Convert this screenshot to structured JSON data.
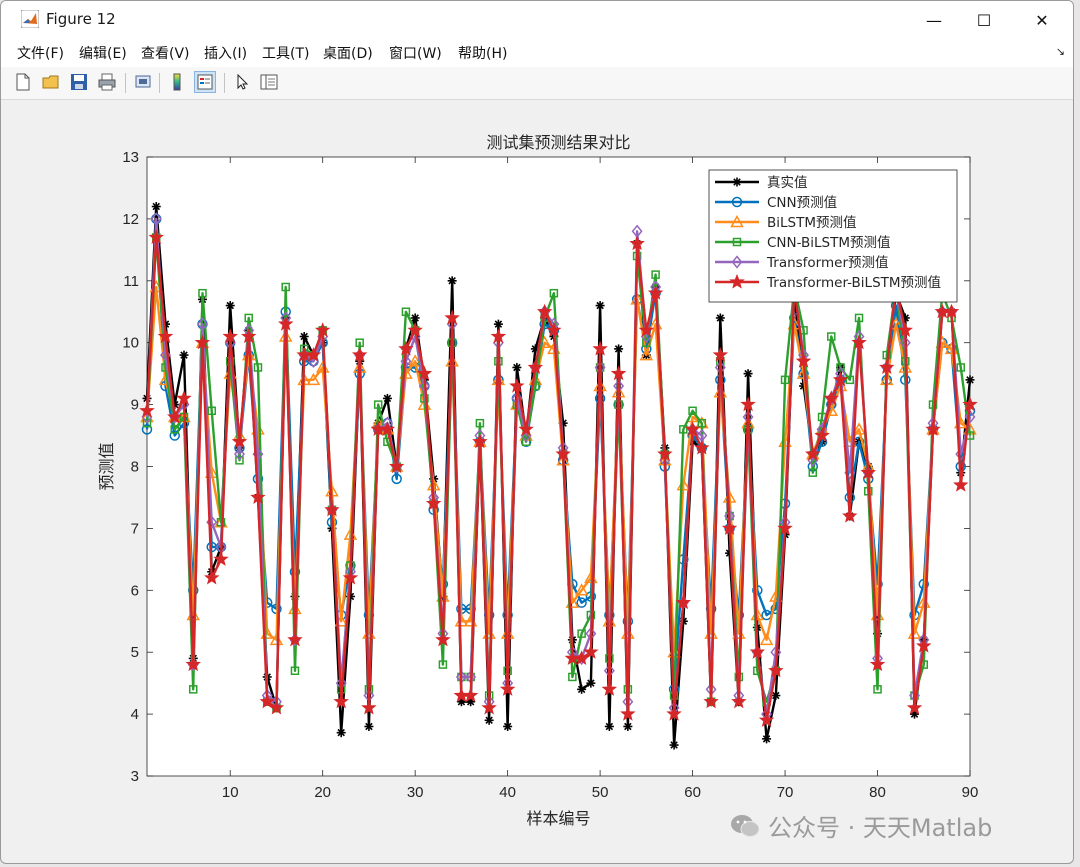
{
  "window": {
    "title": "Figure 12",
    "minimize": "—",
    "maximize": "☐",
    "close": "✕"
  },
  "menu": [
    "文件(F)",
    "编辑(E)",
    "查看(V)",
    "插入(I)",
    "工具(T)",
    "桌面(D)",
    "窗口(W)",
    "帮助(H)"
  ],
  "menu_more": "↘",
  "toolbar": [
    "new-icon",
    "open-icon",
    "save-icon",
    "print-icon",
    "export-icon",
    "colorbar-icon",
    "legend-icon",
    "pointer-icon",
    "property-icon"
  ],
  "watermark": "公众号 · 天天Matlab",
  "colors": {
    "series": [
      "#000000",
      "#0072BD",
      "#FF8C1A",
      "#2CA02C",
      "#9467BD",
      "#D62728"
    ],
    "axes_bg": "#ffffff",
    "figure_bg": "#f0f0f0"
  },
  "chart_data": {
    "type": "line",
    "title": "测试集预测结果对比",
    "xlabel": "样本编号",
    "ylabel": "预测值",
    "xlim": [
      1,
      90
    ],
    "ylim": [
      3,
      13
    ],
    "xticks": [
      10,
      20,
      30,
      40,
      50,
      60,
      70,
      80,
      90
    ],
    "yticks": [
      3,
      4,
      5,
      6,
      7,
      8,
      9,
      10,
      11,
      12,
      13
    ],
    "grid": false,
    "legend_position": "top-right",
    "x": [
      1,
      2,
      3,
      4,
      5,
      6,
      7,
      8,
      9,
      10,
      11,
      12,
      13,
      14,
      15,
      16,
      17,
      18,
      19,
      20,
      21,
      22,
      23,
      24,
      25,
      26,
      27,
      28,
      29,
      30,
      31,
      32,
      33,
      34,
      35,
      36,
      37,
      38,
      39,
      40,
      41,
      42,
      43,
      44,
      45,
      46,
      47,
      48,
      49,
      50,
      51,
      52,
      53,
      54,
      55,
      56,
      57,
      58,
      59,
      60,
      61,
      62,
      63,
      64,
      65,
      66,
      67,
      68,
      69,
      70,
      71,
      72,
      73,
      74,
      75,
      76,
      77,
      78,
      79,
      80,
      81,
      82,
      83,
      84,
      85,
      86,
      87,
      88,
      89,
      90
    ],
    "series": [
      {
        "name": "真实值",
        "marker": "asterisk",
        "values": [
          9.1,
          12.2,
          10.3,
          9.0,
          9.8,
          4.9,
          10.7,
          6.3,
          6.7,
          10.6,
          8.3,
          10.2,
          7.5,
          4.6,
          4.1,
          10.4,
          5.9,
          10.1,
          9.8,
          10.0,
          7.0,
          3.7,
          5.9,
          9.7,
          3.8,
          8.7,
          9.1,
          8.0,
          9.9,
          10.4,
          9.4,
          7.8,
          5.9,
          11.0,
          4.2,
          4.2,
          8.4,
          3.9,
          10.3,
          3.8,
          9.6,
          8.5,
          9.9,
          10.4,
          10.1,
          8.7,
          5.2,
          4.4,
          4.5,
          10.6,
          3.8,
          9.9,
          3.8,
          11.6,
          9.8,
          10.9,
          8.3,
          3.5,
          5.5,
          8.4,
          8.3,
          4.2,
          10.4,
          6.6,
          4.2,
          9.5,
          5.4,
          3.6,
          4.3,
          6.9,
          10.8,
          9.3,
          8.2,
          8.4,
          9.0,
          9.6,
          7.2,
          8.4,
          8.0,
          5.3,
          9.6,
          10.8,
          10.4,
          4.0,
          5.2,
          8.6,
          10.5,
          10.5,
          7.9,
          9.4
        ]
      },
      {
        "name": "CNN预测值",
        "marker": "circle",
        "values": [
          8.6,
          12.0,
          9.3,
          8.5,
          8.7,
          6.0,
          10.3,
          6.7,
          6.7,
          10.0,
          8.3,
          9.8,
          7.8,
          5.8,
          5.7,
          10.5,
          6.3,
          9.7,
          9.7,
          10.0,
          7.1,
          5.6,
          6.4,
          9.5,
          5.6,
          8.6,
          8.7,
          7.8,
          9.6,
          9.6,
          9.3,
          7.3,
          6.1,
          10.0,
          5.7,
          5.7,
          8.4,
          5.6,
          9.4,
          5.6,
          9.1,
          8.4,
          9.3,
          10.3,
          10.2,
          8.1,
          6.1,
          5.8,
          5.9,
          9.1,
          5.6,
          9.0,
          5.5,
          10.7,
          9.9,
          10.8,
          8.0,
          4.4,
          6.5,
          8.5,
          8.3,
          5.7,
          9.4,
          7.0,
          5.6,
          8.6,
          6.0,
          5.6,
          5.7,
          7.4,
          10.4,
          9.5,
          8.0,
          8.4,
          9.0,
          9.4,
          7.5,
          8.4,
          7.8,
          6.1,
          9.4,
          10.6,
          9.4,
          5.6,
          6.1,
          8.6,
          10.0,
          9.9,
          8.0,
          8.9
        ]
      },
      {
        "name": "BiLSTM预测值",
        "marker": "triangle",
        "values": [
          8.8,
          10.9,
          9.4,
          8.8,
          8.8,
          5.6,
          10.0,
          7.9,
          7.1,
          9.5,
          8.5,
          9.8,
          8.6,
          5.3,
          5.2,
          10.1,
          5.7,
          9.4,
          9.4,
          9.6,
          7.6,
          5.5,
          6.9,
          9.6,
          5.3,
          8.7,
          8.6,
          8.0,
          9.5,
          9.7,
          9.0,
          7.7,
          5.9,
          9.7,
          5.5,
          5.5,
          8.4,
          5.3,
          9.4,
          5.3,
          9.0,
          8.5,
          9.4,
          10.0,
          9.9,
          8.1,
          5.8,
          6.0,
          6.2,
          9.3,
          5.5,
          9.2,
          5.3,
          10.7,
          9.8,
          10.3,
          8.1,
          5.0,
          7.7,
          8.8,
          8.7,
          5.3,
          9.2,
          7.5,
          5.3,
          8.7,
          5.6,
          5.2,
          5.9,
          8.4,
          10.3,
          9.5,
          8.2,
          8.6,
          8.9,
          9.3,
          8.4,
          8.6,
          8.0,
          5.6,
          9.4,
          10.3,
          9.6,
          5.3,
          5.8,
          8.6,
          10.0,
          9.9,
          8.7,
          8.6
        ]
      },
      {
        "name": "CNN-BiLSTM预测值",
        "marker": "square",
        "values": [
          8.7,
          11.7,
          9.6,
          8.6,
          8.8,
          4.4,
          10.8,
          8.9,
          7.1,
          9.7,
          8.1,
          10.4,
          9.6,
          4.2,
          4.1,
          10.9,
          4.7,
          9.9,
          9.8,
          10.2,
          7.3,
          4.4,
          6.4,
          10.0,
          4.4,
          9.0,
          8.4,
          8.0,
          10.5,
          10.2,
          9.1,
          7.4,
          4.8,
          10.0,
          4.6,
          4.6,
          8.7,
          4.3,
          9.7,
          4.7,
          9.0,
          8.4,
          9.3,
          10.4,
          10.8,
          8.2,
          4.6,
          5.3,
          5.6,
          9.6,
          4.9,
          9.0,
          4.4,
          11.4,
          10.0,
          11.1,
          8.2,
          4.3,
          8.6,
          8.9,
          8.7,
          4.2,
          9.7,
          7.2,
          4.6,
          8.6,
          4.7,
          4.2,
          4.7,
          9.4,
          10.9,
          10.2,
          7.9,
          8.8,
          10.1,
          9.6,
          9.4,
          10.4,
          7.6,
          4.4,
          9.8,
          10.9,
          9.7,
          4.3,
          4.8,
          9.0,
          10.8,
          10.4,
          9.6,
          8.5
        ]
      },
      {
        "name": "Transformer预测值",
        "marker": "diamond",
        "values": [
          8.8,
          12.0,
          9.8,
          8.8,
          9.0,
          4.8,
          10.3,
          7.1,
          6.7,
          10.0,
          8.2,
          10.2,
          8.2,
          4.3,
          4.2,
          10.4,
          5.2,
          9.8,
          9.7,
          10.1,
          7.3,
          4.5,
          6.3,
          9.8,
          4.3,
          8.6,
          8.7,
          8.0,
          9.7,
          10.1,
          9.3,
          7.5,
          5.3,
          10.3,
          4.6,
          4.6,
          8.5,
          4.2,
          10.0,
          4.5,
          9.1,
          8.5,
          9.6,
          10.5,
          10.3,
          8.3,
          5.0,
          4.9,
          5.3,
          9.6,
          4.7,
          9.3,
          4.2,
          11.8,
          10.1,
          10.9,
          8.1,
          4.1,
          5.8,
          8.6,
          8.5,
          4.4,
          9.6,
          7.2,
          4.3,
          8.8,
          5.0,
          4.0,
          5.0,
          7.1,
          10.9,
          9.8,
          8.1,
          8.6,
          9.1,
          9.5,
          7.9,
          10.1,
          7.9,
          4.9,
          9.6,
          10.9,
          10.0,
          4.3,
          5.2,
          8.7,
          10.5,
          10.5,
          8.2,
          8.8
        ]
      },
      {
        "name": "Transformer-BiLSTM预测值",
        "marker": "star",
        "values": [
          8.9,
          11.7,
          10.1,
          8.8,
          9.1,
          4.8,
          10.0,
          6.2,
          6.5,
          10.1,
          8.4,
          10.1,
          7.5,
          4.2,
          4.1,
          10.3,
          5.2,
          9.8,
          9.8,
          10.2,
          7.3,
          4.2,
          6.2,
          9.8,
          4.1,
          8.6,
          8.6,
          8.0,
          9.9,
          10.2,
          9.5,
          7.4,
          5.2,
          10.4,
          4.3,
          4.3,
          8.4,
          4.1,
          10.1,
          4.4,
          9.3,
          8.6,
          9.6,
          10.5,
          10.2,
          8.2,
          4.9,
          4.9,
          5.0,
          9.9,
          4.4,
          9.5,
          4.0,
          11.6,
          10.2,
          10.8,
          8.2,
          4.0,
          5.8,
          8.6,
          8.3,
          4.2,
          9.8,
          7.0,
          4.2,
          9.0,
          5.0,
          3.9,
          4.7,
          7.0,
          10.9,
          9.7,
          8.2,
          8.5,
          9.1,
          9.4,
          7.2,
          10.0,
          7.9,
          4.8,
          9.6,
          10.9,
          10.2,
          4.1,
          5.1,
          8.6,
          10.5,
          10.5,
          7.7,
          9.0
        ]
      }
    ]
  }
}
